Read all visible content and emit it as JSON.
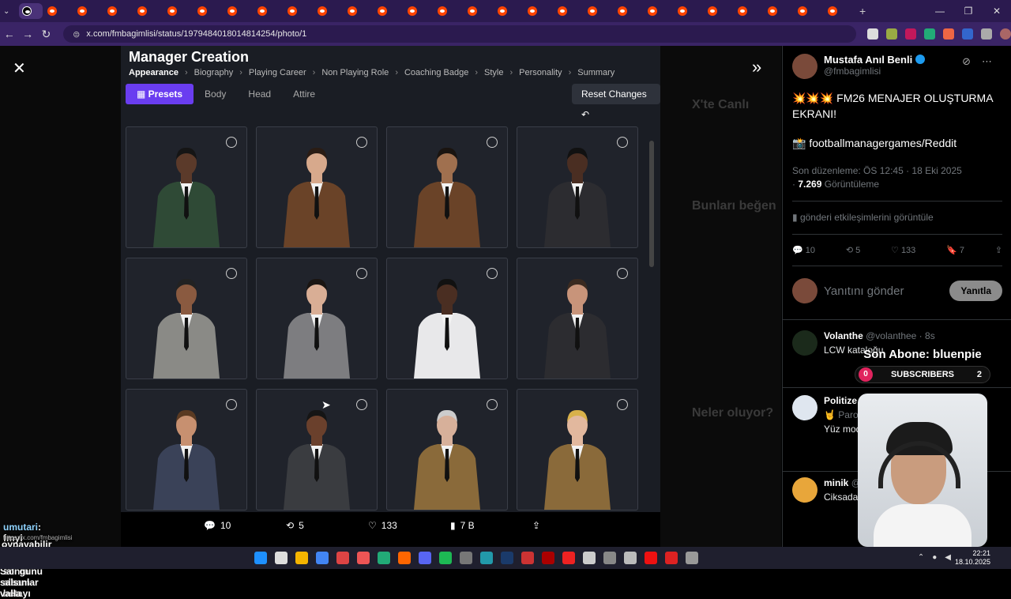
{
  "browser": {
    "url": "x.com/fmbagimlisi/status/1979484018014814254/photo/1",
    "tab_count": 28,
    "new_tab": "+"
  },
  "game": {
    "title": "Manager Creation",
    "breadcrumbs": [
      "Appearance",
      "Biography",
      "Playing Career",
      "Non Playing Role",
      "Coaching Badge",
      "Style",
      "Personality",
      "Summary"
    ],
    "tabs": [
      "Presets",
      "Body",
      "Head",
      "Attire"
    ],
    "reset": "Reset Changes",
    "presets": [
      {
        "skin": "#5b3a2a",
        "suit": "#2f4a36",
        "hair": "#151515"
      },
      {
        "skin": "#d7a98c",
        "suit": "#6a4328",
        "hair": "#2a1c14"
      },
      {
        "skin": "#a0704f",
        "suit": "#6a4328",
        "hair": "#1a1410"
      },
      {
        "skin": "#4a2e22",
        "suit": "#2c2c30",
        "hair": "#111"
      },
      {
        "skin": "#8a5a40",
        "suit": "#8a8a86",
        "hair": "#222"
      },
      {
        "skin": "#d9ae95",
        "suit": "#7d7d80",
        "hair": "#1a1512"
      },
      {
        "skin": "#4a2e22",
        "suit": "#e8e8ea",
        "hair": "#111"
      },
      {
        "skin": "#c8947a",
        "suit": "#2c2c30",
        "hair": "#3a2a20"
      },
      {
        "skin": "#c79070",
        "suit": "#3a4258",
        "hair": "#5a3a22"
      },
      {
        "skin": "#6a402c",
        "suit": "#3a3c40",
        "hair": "#151515"
      },
      {
        "skin": "#d7b09a",
        "suit": "#8a6a3a",
        "hair": "#ccc"
      },
      {
        "skin": "#e2b89e",
        "suit": "#8a6a3a",
        "hair": "#d8b14a"
      }
    ]
  },
  "actions": {
    "replies": "10",
    "reposts": "5",
    "likes": "133",
    "views": "7 B"
  },
  "overlay_chat": {
    "line1_user": "umutari",
    "line1_text": ": fmyi beta çıktıktan sonra alsam betayı",
    "line1_url": "https://x.com/fmbagimlisi",
    "line2_text": "oynayabilir miyim",
    "line3_user": "azizcan35",
    "line3_text": ": Salı günü salsınlar valla"
  },
  "dim_background": {
    "live": "X'te Canlı",
    "suggest": "Bunları beğen",
    "happening": "Neler oluyor?"
  },
  "tweet": {
    "author": "Mustafa Anıl Benli",
    "handle": "@fmbagimlisi",
    "text": "💥💥💥 FM26 MENAJER OLUŞTURMA EKRANI!",
    "source": "📸 footballmanagergames/Reddit",
    "edited": "Son düzenleme: ÖS 12:45 · 18 Eki 2025",
    "views_count": "7.269",
    "views_label": "Görüntüleme",
    "engagement": "gönderi etkileşimlerini görüntüle",
    "stats": {
      "replies": "10",
      "reposts": "5",
      "likes": "133",
      "bookmarks": "7"
    },
    "reply_placeholder": "Yanıtını gönder",
    "reply_button": "Yanıtla"
  },
  "comments": [
    {
      "name": "Volanthe",
      "handle": "@volanthee · 8s",
      "text": "LCW kataloğu"
    },
    {
      "name": "Politize",
      "handle": "",
      "text": "Yüz mod"
    },
    {
      "name": "minik",
      "handle": "@",
      "text": "Ciksada Mustafa"
    }
  ],
  "comment_extra": {
    "politize_sub": "🤘 Paro"
  },
  "sub_overlay": {
    "title": "Son Abone: bluenpie",
    "count_left": "0",
    "label": "SUBSCRIBERS",
    "count_right": "2"
  },
  "taskbar": {
    "time": "22:21",
    "date": "18.10.2025"
  }
}
